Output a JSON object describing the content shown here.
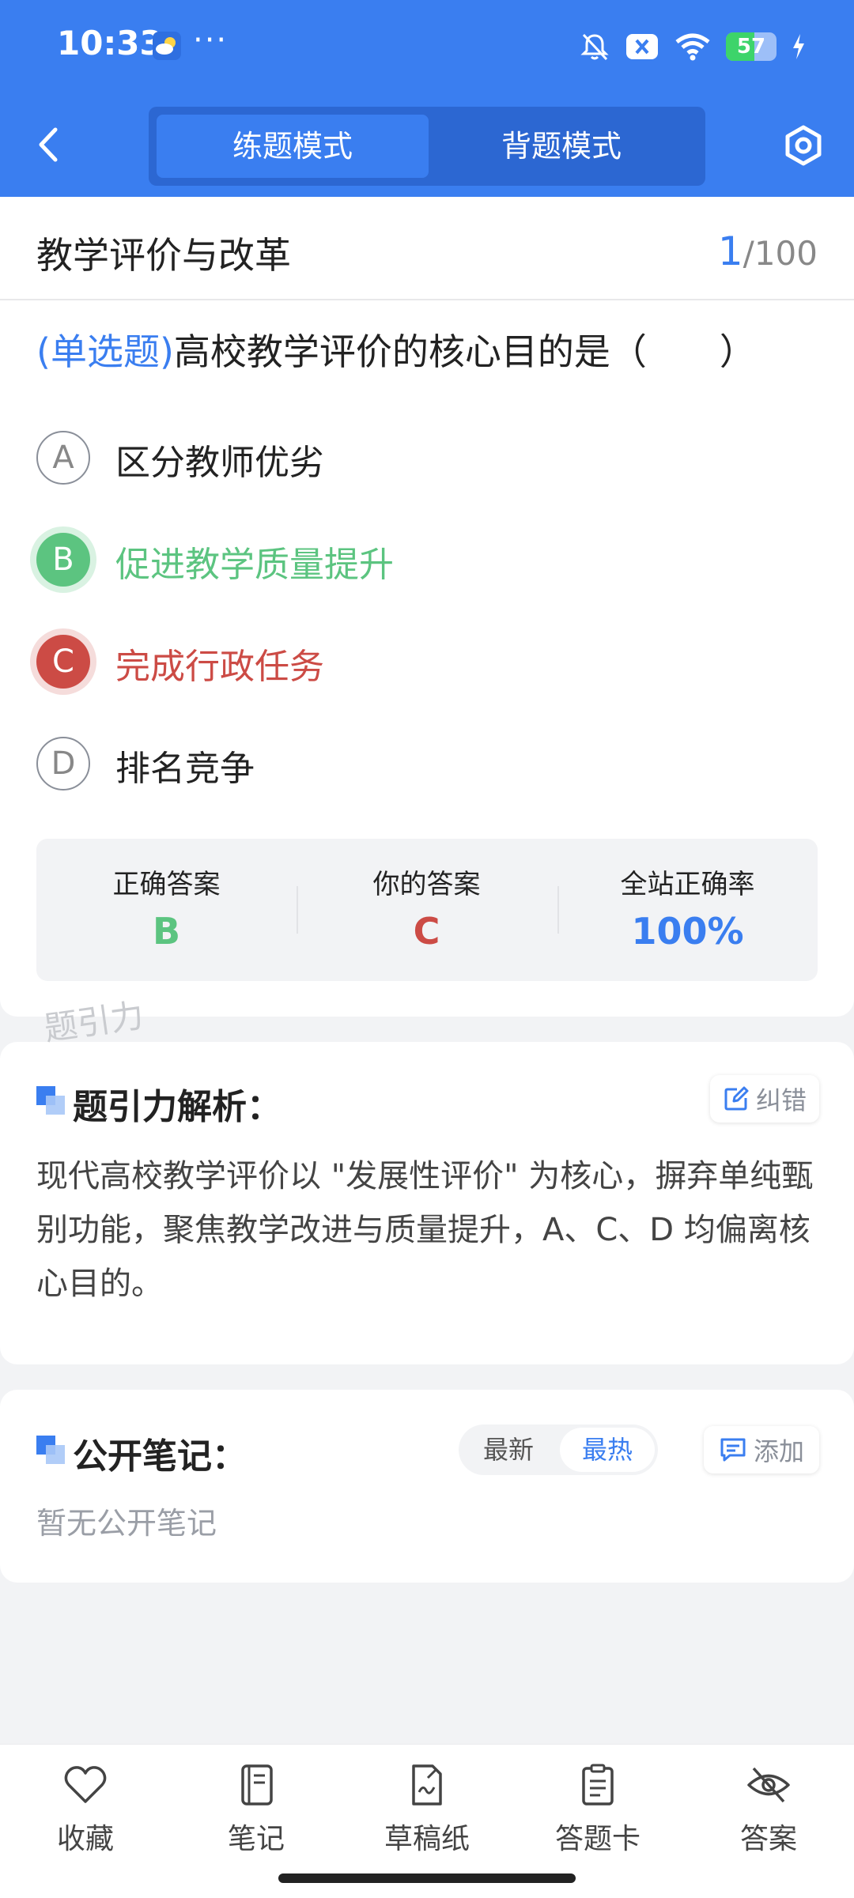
{
  "status_bar": {
    "time": "10:33",
    "more": "···",
    "battery_level": "57",
    "battery_fraction": 0.57,
    "icons": [
      "weather-icon",
      "mute-icon",
      "close-box-icon",
      "wifi-icon",
      "battery-icon",
      "charging-icon"
    ]
  },
  "header": {
    "back_icon": "chevron-left-icon",
    "tabs": [
      {
        "label": "练题模式",
        "active": true
      },
      {
        "label": "背题模式",
        "active": false
      }
    ],
    "settings_icon": "hexagon-gear-icon",
    "accent_color": "#3a7ef0"
  },
  "question": {
    "chapter": "教学评价与改革",
    "current": "1",
    "total": "/100",
    "type_label": "(单选题)",
    "text": "高校教学评价的核心目的是（　　）",
    "options": [
      {
        "letter": "A",
        "text": "区分教师优劣",
        "state": "normal"
      },
      {
        "letter": "B",
        "text": "促进教学质量提升",
        "state": "correct"
      },
      {
        "letter": "C",
        "text": "完成行政任务",
        "state": "wrong"
      },
      {
        "letter": "D",
        "text": "排名竞争",
        "state": "normal"
      }
    ]
  },
  "answer_summary": {
    "correct_label": "正确答案",
    "correct_value": "B",
    "yours_label": "你的答案",
    "yours_value": "C",
    "rate_label": "全站正确率",
    "rate_value": "100%",
    "colors": {
      "correct": "#5cc480",
      "wrong": "#cc4b45",
      "rate": "#3a7ef0"
    }
  },
  "watermark": "题引力",
  "analysis": {
    "title": "题引力解析：",
    "report_button": "纠错",
    "text": "现代高校教学评价以 \"发展性评价\" 为核心，摒弃单纯甄别功能，聚焦教学改进与质量提升，A、C、D 均偏离核心目的。"
  },
  "notes": {
    "title": "公开笔记：",
    "sort_latest": "最新",
    "sort_hot": "最热",
    "add_button": "添加",
    "empty_text": "暂无公开笔记"
  },
  "bottom_nav": [
    {
      "label": "收藏",
      "icon": "heart-icon"
    },
    {
      "label": "笔记",
      "icon": "notebook-icon"
    },
    {
      "label": "草稿纸",
      "icon": "draft-paper-icon"
    },
    {
      "label": "答题卡",
      "icon": "answer-sheet-icon"
    },
    {
      "label": "答案",
      "icon": "eye-off-icon"
    }
  ]
}
